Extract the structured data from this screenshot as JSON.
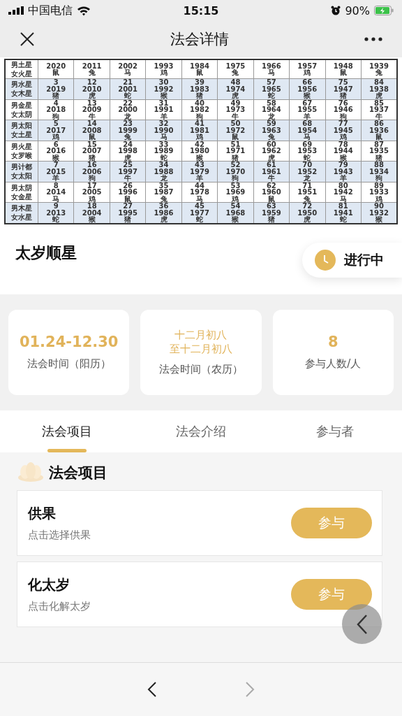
{
  "status_bar": {
    "carrier": "中国电信",
    "time": "15:15",
    "battery": "90%"
  },
  "nav": {
    "title": "法会详情"
  },
  "table": {
    "rows": [
      {
        "label": [
          "男土星",
          "女火星"
        ],
        "cells": [
          [
            "2020",
            "鼠"
          ],
          [
            "2011",
            "兔"
          ],
          [
            "2002",
            "马"
          ],
          [
            "1993",
            "鸡"
          ],
          [
            "1984",
            "鼠"
          ],
          [
            "1975",
            "兔"
          ],
          [
            "1966",
            "马"
          ],
          [
            "1957",
            "鸡"
          ],
          [
            "1948",
            "鼠"
          ],
          [
            "1939",
            "兔"
          ]
        ]
      },
      {
        "label": [
          "男水星",
          "女木星"
        ],
        "cells": [
          [
            "3",
            "2019",
            "猪"
          ],
          [
            "12",
            "2010",
            "虎"
          ],
          [
            "21",
            "2001",
            "蛇"
          ],
          [
            "30",
            "1992",
            "猴"
          ],
          [
            "39",
            "1983",
            "猪"
          ],
          [
            "48",
            "1974",
            "虎"
          ],
          [
            "57",
            "1965",
            "蛇"
          ],
          [
            "66",
            "1956",
            "猴"
          ],
          [
            "75",
            "1947",
            "猪"
          ],
          [
            "84",
            "1938",
            "虎"
          ]
        ]
      },
      {
        "label": [
          "男金星",
          "女太阴"
        ],
        "cells": [
          [
            "4",
            "2018",
            "狗"
          ],
          [
            "13",
            "2009",
            "牛"
          ],
          [
            "22",
            "2000",
            "龙"
          ],
          [
            "31",
            "1991",
            "羊"
          ],
          [
            "40",
            "1982",
            "狗"
          ],
          [
            "49",
            "1973",
            "牛"
          ],
          [
            "58",
            "1964",
            "龙"
          ],
          [
            "67",
            "1955",
            "羊"
          ],
          [
            "76",
            "1946",
            "狗"
          ],
          [
            "85",
            "1937",
            "牛"
          ]
        ]
      },
      {
        "label": [
          "男太阳",
          "女土星"
        ],
        "cells": [
          [
            "5",
            "2017",
            "鸡"
          ],
          [
            "14",
            "2008",
            "鼠"
          ],
          [
            "23",
            "1999",
            "兔"
          ],
          [
            "32",
            "1990",
            "马"
          ],
          [
            "41",
            "1981",
            "鸡"
          ],
          [
            "50",
            "1972",
            "鼠"
          ],
          [
            "59",
            "1963",
            "兔"
          ],
          [
            "68",
            "1954",
            "马"
          ],
          [
            "77",
            "1945",
            "鸡"
          ],
          [
            "86",
            "1936",
            "鼠"
          ]
        ]
      },
      {
        "label": [
          "男火星",
          "女罗喉"
        ],
        "cells": [
          [
            "6",
            "2016",
            "猴"
          ],
          [
            "15",
            "2007",
            "猪"
          ],
          [
            "24",
            "1998",
            "虎"
          ],
          [
            "33",
            "1989",
            "蛇"
          ],
          [
            "42",
            "1980",
            "猴"
          ],
          [
            "51",
            "1971",
            "猪"
          ],
          [
            "60",
            "1962",
            "虎"
          ],
          [
            "69",
            "1953",
            "蛇"
          ],
          [
            "78",
            "1944",
            "猴"
          ],
          [
            "87",
            "1935",
            "猪"
          ]
        ]
      },
      {
        "label": [
          "男计都",
          "女太阳"
        ],
        "cells": [
          [
            "7",
            "2015",
            "羊"
          ],
          [
            "16",
            "2006",
            "狗"
          ],
          [
            "25",
            "1997",
            "牛"
          ],
          [
            "34",
            "1988",
            "龙"
          ],
          [
            "43",
            "1979",
            "羊"
          ],
          [
            "52",
            "1970",
            "狗"
          ],
          [
            "61",
            "1961",
            "牛"
          ],
          [
            "70",
            "1952",
            "龙"
          ],
          [
            "79",
            "1943",
            "羊"
          ],
          [
            "88",
            "1934",
            "狗"
          ]
        ]
      },
      {
        "label": [
          "男太阴",
          "女金星"
        ],
        "cells": [
          [
            "8",
            "2014",
            "马"
          ],
          [
            "17",
            "2005",
            "鸡"
          ],
          [
            "26",
            "1996",
            "鼠"
          ],
          [
            "35",
            "1987",
            "兔"
          ],
          [
            "44",
            "1978",
            "马"
          ],
          [
            "53",
            "1969",
            "鸡"
          ],
          [
            "62",
            "1960",
            "鼠"
          ],
          [
            "71",
            "1951",
            "兔"
          ],
          [
            "80",
            "1942",
            "马"
          ],
          [
            "89",
            "1933",
            "鸡"
          ]
        ]
      },
      {
        "label": [
          "男木星",
          "女水星"
        ],
        "cells": [
          [
            "9",
            "2013",
            "蛇"
          ],
          [
            "18",
            "2004",
            "猴"
          ],
          [
            "27",
            "1995",
            "猪"
          ],
          [
            "36",
            "1986",
            "虎"
          ],
          [
            "45",
            "1977",
            "蛇"
          ],
          [
            "54",
            "1968",
            "猴"
          ],
          [
            "63",
            "1959",
            "猪"
          ],
          [
            "72",
            "1950",
            "虎"
          ],
          [
            "81",
            "1941",
            "蛇"
          ],
          [
            "90",
            "1932",
            "猴"
          ]
        ]
      }
    ]
  },
  "event": {
    "title": "太岁顺星",
    "status": "进行中"
  },
  "stats": [
    {
      "value": [
        "01.24-12.30"
      ],
      "label": "法会时间（阳历）"
    },
    {
      "value": [
        "十二月初八",
        "至十二月初八"
      ],
      "label": "法会时间（农历）"
    },
    {
      "value": [
        "8"
      ],
      "label": "参与人数/人"
    }
  ],
  "tabs": [
    {
      "label": "法会项目",
      "selected": true
    },
    {
      "label": "法会介绍",
      "selected": false
    },
    {
      "label": "参与者",
      "selected": false
    }
  ],
  "section": {
    "title": "法会项目"
  },
  "items": [
    {
      "name": "供果",
      "desc": "点击选择供果",
      "button": "参与"
    },
    {
      "name": "化太岁",
      "desc": "点击化解太岁",
      "button": "参与"
    }
  ]
}
